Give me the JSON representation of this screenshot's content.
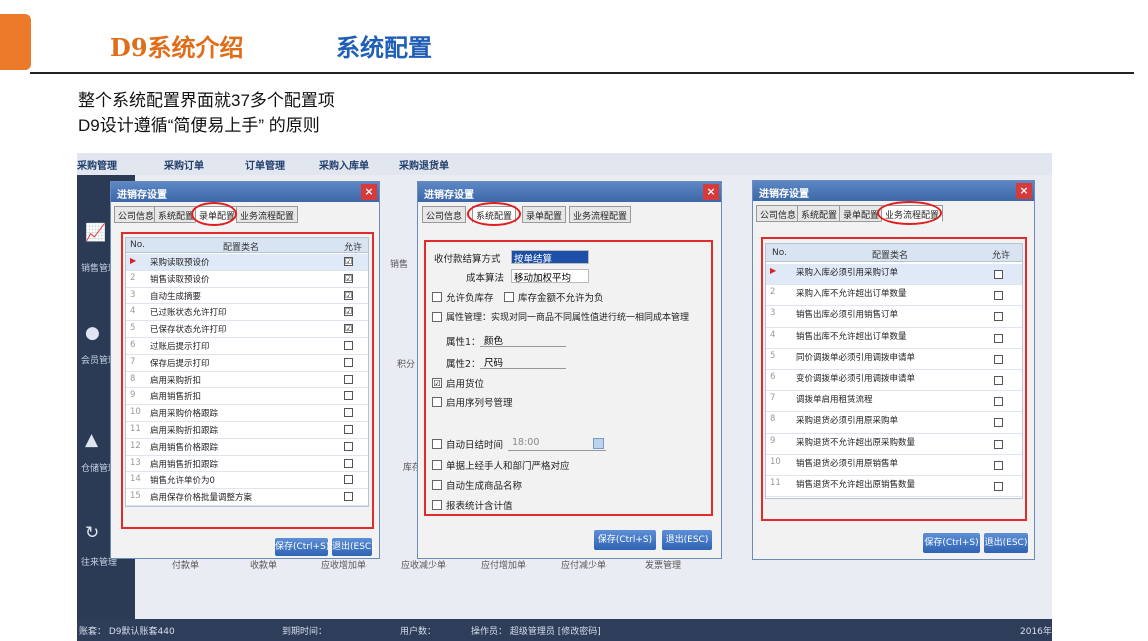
{
  "slide": {
    "title_left": "D9系统介绍",
    "title_right": "系统配置",
    "intro_line1": "整个系统配置界面就37多个配置项",
    "intro_line2": "D9设计遵循“简便易上手” 的原则"
  },
  "background_app": {
    "top_menu": [
      "采购管理",
      "采购订单",
      "订单管理",
      "采购入库单",
      "采购退货单"
    ],
    "left_nav": [
      "销售管理",
      "会员管理",
      "仓储管理",
      "往来管理"
    ],
    "bottom_modules": [
      "付款单",
      "收款单",
      "应收增加单",
      "应收减少单",
      "应付增加单",
      "应付减少单",
      "发票管理"
    ],
    "partial_labels": [
      "销售",
      "积分",
      "库存"
    ],
    "status_bar": [
      "账套： D9默认账套440",
      "到期时间：",
      "用户数：",
      "操作员： 超级管理员 [修改密码]",
      "2016年"
    ]
  },
  "dialogs": {
    "title": "进销存设置",
    "close": "×",
    "tabs": [
      "公司信息",
      "系统配置",
      "录单配置",
      "业务流程配置"
    ],
    "save": "保存(Ctrl+S)",
    "exit": "退出(ESC)",
    "grid_header": {
      "no": "No.",
      "name": "配置类名",
      "allow": "允许"
    }
  },
  "dialog_left": {
    "rows": [
      {
        "no": "1",
        "name": "采购读取预设价",
        "checked": "☑"
      },
      {
        "no": "2",
        "name": "销售读取预设价",
        "checked": "☑"
      },
      {
        "no": "3",
        "name": "自动生成摘要",
        "checked": "☑"
      },
      {
        "no": "4",
        "name": "已过账状态允许打印",
        "checked": "☑"
      },
      {
        "no": "5",
        "name": "已保存状态允许打印",
        "checked": "☑"
      },
      {
        "no": "6",
        "name": "过账后提示打印",
        "checked": ""
      },
      {
        "no": "7",
        "name": "保存后提示打印",
        "checked": ""
      },
      {
        "no": "8",
        "name": "启用采购折扣",
        "checked": ""
      },
      {
        "no": "9",
        "name": "启用销售折扣",
        "checked": ""
      },
      {
        "no": "10",
        "name": "启用采购价格跟踪",
        "checked": ""
      },
      {
        "no": "11",
        "name": "启用采购折扣跟踪",
        "checked": ""
      },
      {
        "no": "12",
        "name": "启用销售价格跟踪",
        "checked": ""
      },
      {
        "no": "13",
        "name": "启用销售折扣跟踪",
        "checked": ""
      },
      {
        "no": "14",
        "name": "销售允许单价为0",
        "checked": ""
      },
      {
        "no": "15",
        "name": "启用保存价格批量调整方案",
        "checked": ""
      }
    ]
  },
  "dialog_middle": {
    "settle_label": "收付款结算方式",
    "settle_value": "按单结算",
    "cost_label": "成本算法",
    "cost_value": "移动加权平均",
    "opt_negative_stock": "允许负库存",
    "opt_amount_nonneg": "库存金额不允许为负",
    "opt_attribute": "属性管理：实现对同一商品不同属性值进行统一相同成本管理",
    "attr1_label": "属性1：",
    "attr1_value": "颜色",
    "attr2_label": "属性2：",
    "attr2_value": "尺码",
    "opt_location": "启用货位",
    "opt_serial": "启用序列号管理",
    "opt_auto_close": "自动日结时间",
    "auto_close_time": "18:00",
    "opt_strict_dept": "单据上经手人和部门严格对应",
    "opt_auto_name": "自动生成商品名称",
    "opt_report_tax": "报表统计含计值",
    "checked_mark": "☑"
  },
  "dialog_right": {
    "rows": [
      {
        "no": "1",
        "name": "采购入库必须引用采购订单"
      },
      {
        "no": "2",
        "name": "采购入库不允许超出订单数量"
      },
      {
        "no": "3",
        "name": "销售出库必须引用销售订单"
      },
      {
        "no": "4",
        "name": "销售出库不允许超出订单数量"
      },
      {
        "no": "5",
        "name": "同价调拨单必须引用调拨申请单"
      },
      {
        "no": "6",
        "name": "变价调拨单必须引用调拨申请单"
      },
      {
        "no": "7",
        "name": "调拨单启用租赁流程"
      },
      {
        "no": "8",
        "name": "采购退货必须引用原采购单"
      },
      {
        "no": "9",
        "name": "采购退货不允许超出原采购数量"
      },
      {
        "no": "10",
        "name": "销售退货必须引用原销售单"
      },
      {
        "no": "11",
        "name": "销售退货不允许超出原销售数量"
      }
    ]
  },
  "colors": {
    "accent_orange": "#ec7a2a",
    "title_blue": "#1f5fb5",
    "annotation_red": "#e22c2c"
  }
}
